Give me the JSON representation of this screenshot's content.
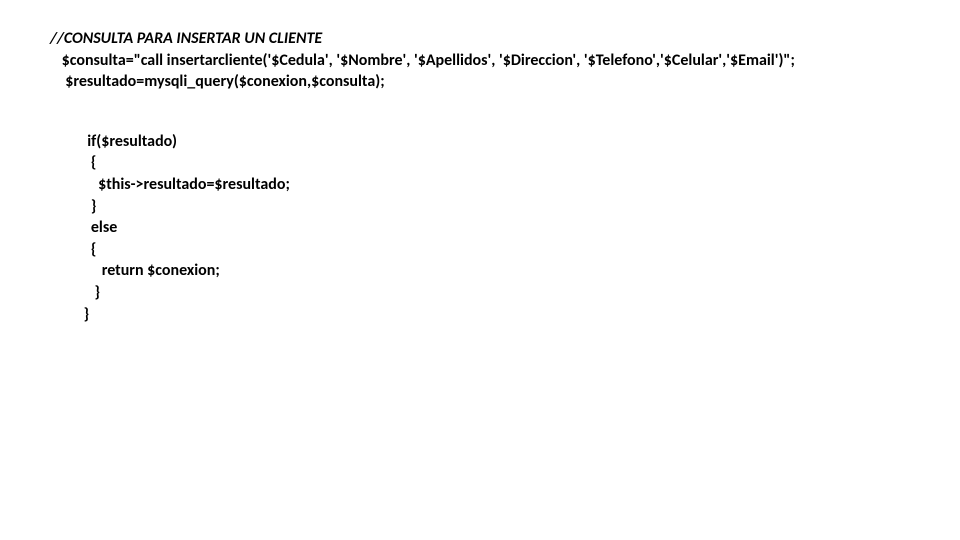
{
  "code": {
    "comment": "//CONSULTA PARA INSERTAR UN CLIENTE",
    "line1": " $consulta=\"call insertarcliente('$Cedula', '$Nombre', '$Apellidos', '$Direccion', '$Telefono','$Celular','$Email')\";",
    "line2": "  $resultado=mysqli_query($conexion,$consulta);",
    "b1": "  if($resultado)",
    "b2": "   {",
    "b3": "     $this->resultado=$resultado;",
    "b4": "   }",
    "b5": "   else",
    "b6": "   {",
    "b7": "      return $conexion;",
    "b8": "    }",
    "b9": " }"
  }
}
